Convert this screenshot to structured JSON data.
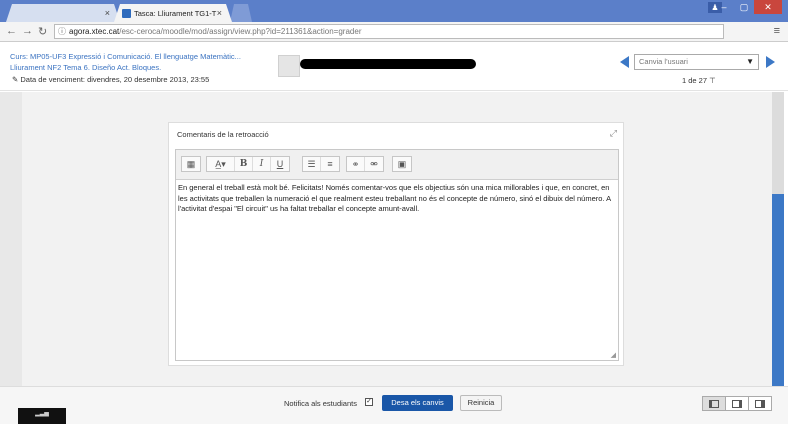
{
  "browser": {
    "tabs": [
      {
        "label": ""
      },
      {
        "label": "Tasca: Lliurament TG1-T"
      }
    ],
    "url_host": "agora.xtec.cat",
    "url_path": "/esc-ceroca/moodle/mod/assign/view.php?id=211361&action=grader",
    "window_controls": [
      "–",
      "▢",
      "✕"
    ]
  },
  "header": {
    "course_line": "Curs: MP05-UF3 Expressió i Comunicació. El llenguatge Matemàtic...",
    "assignment_line": "Lliurament NF2 Tema 6. Diseño Act. Bloques.",
    "due_date": "Data de venciment: divendres, 20 desembre 2013, 23:55",
    "user_select_placeholder": "Canvia l'usuari",
    "counter": "1 de 27"
  },
  "feedback": {
    "title": "Comentaris de la retroacció",
    "toolbar_icons": [
      "table-icon",
      "font-size-icon",
      "bold-icon",
      "italic-icon",
      "underline-icon",
      "bullet-list-icon",
      "numbered-list-icon",
      "link-icon",
      "unlink-icon",
      "image-icon"
    ],
    "body": "En general el treball està molt bé. Felicitats! Només comentar-vos que els objectius són una mica millorables i que, en concret, en les activitats que treballen la numeració el que realment esteu treballant no és el concepte de número, sinó el dibuix del número. A l'activitat d'espai \"El circuit\" us ha faltat treballar el concepte amunt-avall."
  },
  "footer": {
    "notify_label": "Notifica als estudiants",
    "notify_checked": true,
    "save_label": "Desa els canvis",
    "reset_label": "Reinicia"
  },
  "colors": {
    "tabstrip": "#5b7fc9",
    "link": "#3b73c1",
    "primary_button": "#1a57a8",
    "scroll_thumb": "#3c78c6"
  }
}
